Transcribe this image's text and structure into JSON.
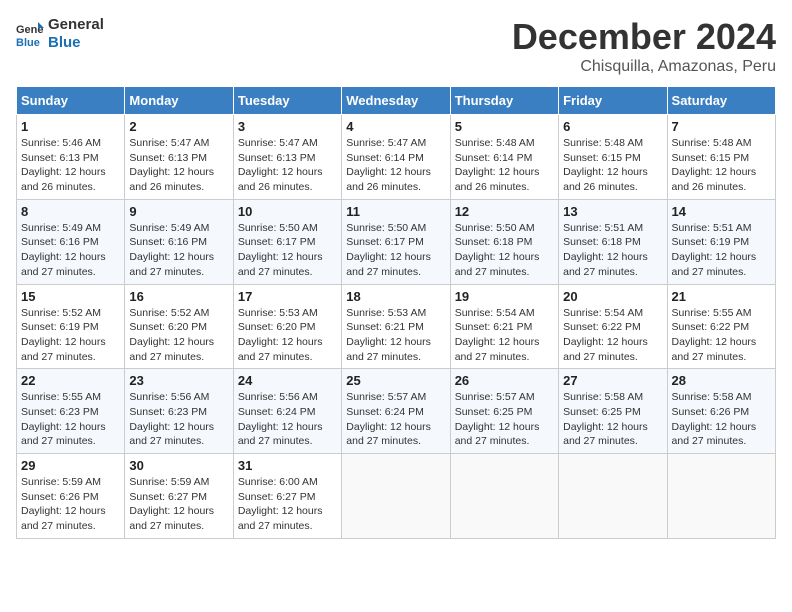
{
  "logo": {
    "line1": "General",
    "line2": "Blue"
  },
  "title": "December 2024",
  "location": "Chisquilla, Amazonas, Peru",
  "weekdays": [
    "Sunday",
    "Monday",
    "Tuesday",
    "Wednesday",
    "Thursday",
    "Friday",
    "Saturday"
  ],
  "weeks": [
    [
      {
        "day": "1",
        "info": "Sunrise: 5:46 AM\nSunset: 6:13 PM\nDaylight: 12 hours\nand 26 minutes."
      },
      {
        "day": "2",
        "info": "Sunrise: 5:47 AM\nSunset: 6:13 PM\nDaylight: 12 hours\nand 26 minutes."
      },
      {
        "day": "3",
        "info": "Sunrise: 5:47 AM\nSunset: 6:13 PM\nDaylight: 12 hours\nand 26 minutes."
      },
      {
        "day": "4",
        "info": "Sunrise: 5:47 AM\nSunset: 6:14 PM\nDaylight: 12 hours\nand 26 minutes."
      },
      {
        "day": "5",
        "info": "Sunrise: 5:48 AM\nSunset: 6:14 PM\nDaylight: 12 hours\nand 26 minutes."
      },
      {
        "day": "6",
        "info": "Sunrise: 5:48 AM\nSunset: 6:15 PM\nDaylight: 12 hours\nand 26 minutes."
      },
      {
        "day": "7",
        "info": "Sunrise: 5:48 AM\nSunset: 6:15 PM\nDaylight: 12 hours\nand 26 minutes."
      }
    ],
    [
      {
        "day": "8",
        "info": "Sunrise: 5:49 AM\nSunset: 6:16 PM\nDaylight: 12 hours\nand 27 minutes."
      },
      {
        "day": "9",
        "info": "Sunrise: 5:49 AM\nSunset: 6:16 PM\nDaylight: 12 hours\nand 27 minutes."
      },
      {
        "day": "10",
        "info": "Sunrise: 5:50 AM\nSunset: 6:17 PM\nDaylight: 12 hours\nand 27 minutes."
      },
      {
        "day": "11",
        "info": "Sunrise: 5:50 AM\nSunset: 6:17 PM\nDaylight: 12 hours\nand 27 minutes."
      },
      {
        "day": "12",
        "info": "Sunrise: 5:50 AM\nSunset: 6:18 PM\nDaylight: 12 hours\nand 27 minutes."
      },
      {
        "day": "13",
        "info": "Sunrise: 5:51 AM\nSunset: 6:18 PM\nDaylight: 12 hours\nand 27 minutes."
      },
      {
        "day": "14",
        "info": "Sunrise: 5:51 AM\nSunset: 6:19 PM\nDaylight: 12 hours\nand 27 minutes."
      }
    ],
    [
      {
        "day": "15",
        "info": "Sunrise: 5:52 AM\nSunset: 6:19 PM\nDaylight: 12 hours\nand 27 minutes."
      },
      {
        "day": "16",
        "info": "Sunrise: 5:52 AM\nSunset: 6:20 PM\nDaylight: 12 hours\nand 27 minutes."
      },
      {
        "day": "17",
        "info": "Sunrise: 5:53 AM\nSunset: 6:20 PM\nDaylight: 12 hours\nand 27 minutes."
      },
      {
        "day": "18",
        "info": "Sunrise: 5:53 AM\nSunset: 6:21 PM\nDaylight: 12 hours\nand 27 minutes."
      },
      {
        "day": "19",
        "info": "Sunrise: 5:54 AM\nSunset: 6:21 PM\nDaylight: 12 hours\nand 27 minutes."
      },
      {
        "day": "20",
        "info": "Sunrise: 5:54 AM\nSunset: 6:22 PM\nDaylight: 12 hours\nand 27 minutes."
      },
      {
        "day": "21",
        "info": "Sunrise: 5:55 AM\nSunset: 6:22 PM\nDaylight: 12 hours\nand 27 minutes."
      }
    ],
    [
      {
        "day": "22",
        "info": "Sunrise: 5:55 AM\nSunset: 6:23 PM\nDaylight: 12 hours\nand 27 minutes."
      },
      {
        "day": "23",
        "info": "Sunrise: 5:56 AM\nSunset: 6:23 PM\nDaylight: 12 hours\nand 27 minutes."
      },
      {
        "day": "24",
        "info": "Sunrise: 5:56 AM\nSunset: 6:24 PM\nDaylight: 12 hours\nand 27 minutes."
      },
      {
        "day": "25",
        "info": "Sunrise: 5:57 AM\nSunset: 6:24 PM\nDaylight: 12 hours\nand 27 minutes."
      },
      {
        "day": "26",
        "info": "Sunrise: 5:57 AM\nSunset: 6:25 PM\nDaylight: 12 hours\nand 27 minutes."
      },
      {
        "day": "27",
        "info": "Sunrise: 5:58 AM\nSunset: 6:25 PM\nDaylight: 12 hours\nand 27 minutes."
      },
      {
        "day": "28",
        "info": "Sunrise: 5:58 AM\nSunset: 6:26 PM\nDaylight: 12 hours\nand 27 minutes."
      }
    ],
    [
      {
        "day": "29",
        "info": "Sunrise: 5:59 AM\nSunset: 6:26 PM\nDaylight: 12 hours\nand 27 minutes."
      },
      {
        "day": "30",
        "info": "Sunrise: 5:59 AM\nSunset: 6:27 PM\nDaylight: 12 hours\nand 27 minutes."
      },
      {
        "day": "31",
        "info": "Sunrise: 6:00 AM\nSunset: 6:27 PM\nDaylight: 12 hours\nand 27 minutes."
      },
      {
        "day": "",
        "info": ""
      },
      {
        "day": "",
        "info": ""
      },
      {
        "day": "",
        "info": ""
      },
      {
        "day": "",
        "info": ""
      }
    ]
  ]
}
